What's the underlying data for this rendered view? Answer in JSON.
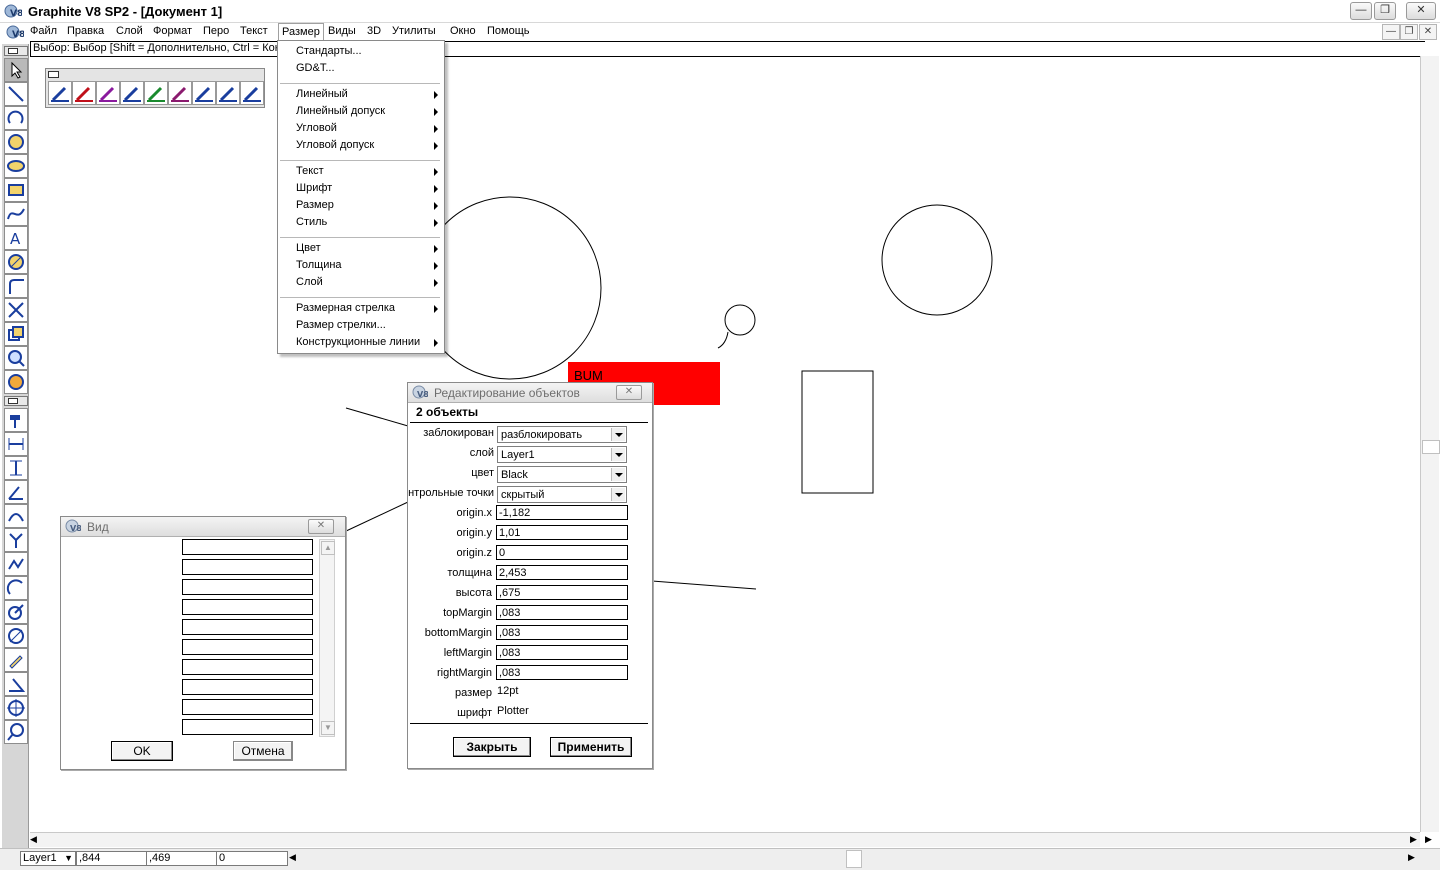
{
  "window": {
    "title": "Graphite V8 SP2 - [Документ 1]",
    "controls": {
      "minimize": "—",
      "restore": "❐",
      "close": "✕"
    }
  },
  "menubar": {
    "items": [
      "Файл",
      "Правка",
      "Слой",
      "Формат",
      "Перо",
      "Текст",
      "Размер",
      "Виды",
      "3D",
      "Утилиты",
      "Окно",
      "Помощь"
    ],
    "active": "Размер"
  },
  "prompt": "Выбор: Выбор  [Shift = Дополнительно, Ctrl = Кон",
  "dimension_menu": {
    "groups": [
      [
        {
          "label": "Стандарты...",
          "submenu": false
        },
        {
          "label": "GD&T...",
          "submenu": false
        }
      ],
      [
        {
          "label": "Линейный",
          "submenu": true
        },
        {
          "label": "Линейный допуск",
          "submenu": true
        },
        {
          "label": "Угловой",
          "submenu": true
        },
        {
          "label": "Угловой допуск",
          "submenu": true
        }
      ],
      [
        {
          "label": "Текст",
          "submenu": true
        },
        {
          "label": "Шрифт",
          "submenu": true
        },
        {
          "label": "Размер",
          "submenu": true
        },
        {
          "label": "Стиль",
          "submenu": true
        }
      ],
      [
        {
          "label": "Цвет",
          "submenu": true
        },
        {
          "label": "Толщина",
          "submenu": true
        },
        {
          "label": "Слой",
          "submenu": true
        }
      ],
      [
        {
          "label": "Размерная стрелка",
          "submenu": true
        },
        {
          "label": "Размер стрелки...",
          "submenu": false
        },
        {
          "label": "Конструкционные линии",
          "submenu": true
        }
      ]
    ]
  },
  "canvas": {
    "text_label": "BUM",
    "text_highlight_color": "#ff0000"
  },
  "edit_dialog": {
    "title": "Редактирование объектов",
    "selection": "2 объекты",
    "locked": {
      "label": "заблокирован",
      "value": "разблокировать"
    },
    "layer": {
      "label": "слой",
      "value": "Layer1"
    },
    "color": {
      "label": "цвет",
      "value": "Black"
    },
    "control_points": {
      "label": "нтрольные точки",
      "value": "скрытый"
    },
    "fields": [
      {
        "label": "origin.x",
        "value": "-1,182"
      },
      {
        "label": "origin.y",
        "value": "1,01"
      },
      {
        "label": "origin.z",
        "value": "0"
      },
      {
        "label": "толщина",
        "value": "2,453"
      },
      {
        "label": "высота",
        "value": ",675"
      },
      {
        "label": "topMargin",
        "value": ",083"
      },
      {
        "label": "bottomMargin",
        "value": ",083"
      },
      {
        "label": "leftMargin",
        "value": ",083"
      },
      {
        "label": "rightMargin",
        "value": ",083"
      }
    ],
    "size": {
      "label": "размер",
      "value": "12pt"
    },
    "font": {
      "label": "шрифт",
      "value": "Plotter"
    },
    "close_label": "Закрыть",
    "apply_label": "Применить"
  },
  "view_dialog": {
    "title": "Вид",
    "ok_label": "OK",
    "cancel_label": "Отмена",
    "rows": [
      "",
      "",
      "",
      "",
      "",
      "",
      "",
      "",
      "",
      ""
    ]
  },
  "statusbar": {
    "layer": "Layer1",
    "x": ",844",
    "y": ",469",
    "z": "0"
  },
  "icons": {
    "app": "graphite-v8-logo",
    "tools": [
      "pointer-icon",
      "line-icon",
      "arc-icon",
      "circle-icon",
      "ellipse-icon",
      "rectangle-icon",
      "spline-icon",
      "text-icon",
      "dimension-icon",
      "fillet-icon",
      "trim-icon",
      "group-icon",
      "zoom-icon",
      "render-icon",
      "hammer-icon",
      "distance-icon",
      "vertical-dim-icon",
      "angle-icon",
      "curve-dim-icon",
      "fork-icon",
      "chain-icon",
      "arc-dim-icon",
      "radius-icon",
      "diameter-icon",
      "pen-edit-icon",
      "pen-angle-icon",
      "crosshair-icon",
      "magnifier-icon"
    ]
  }
}
